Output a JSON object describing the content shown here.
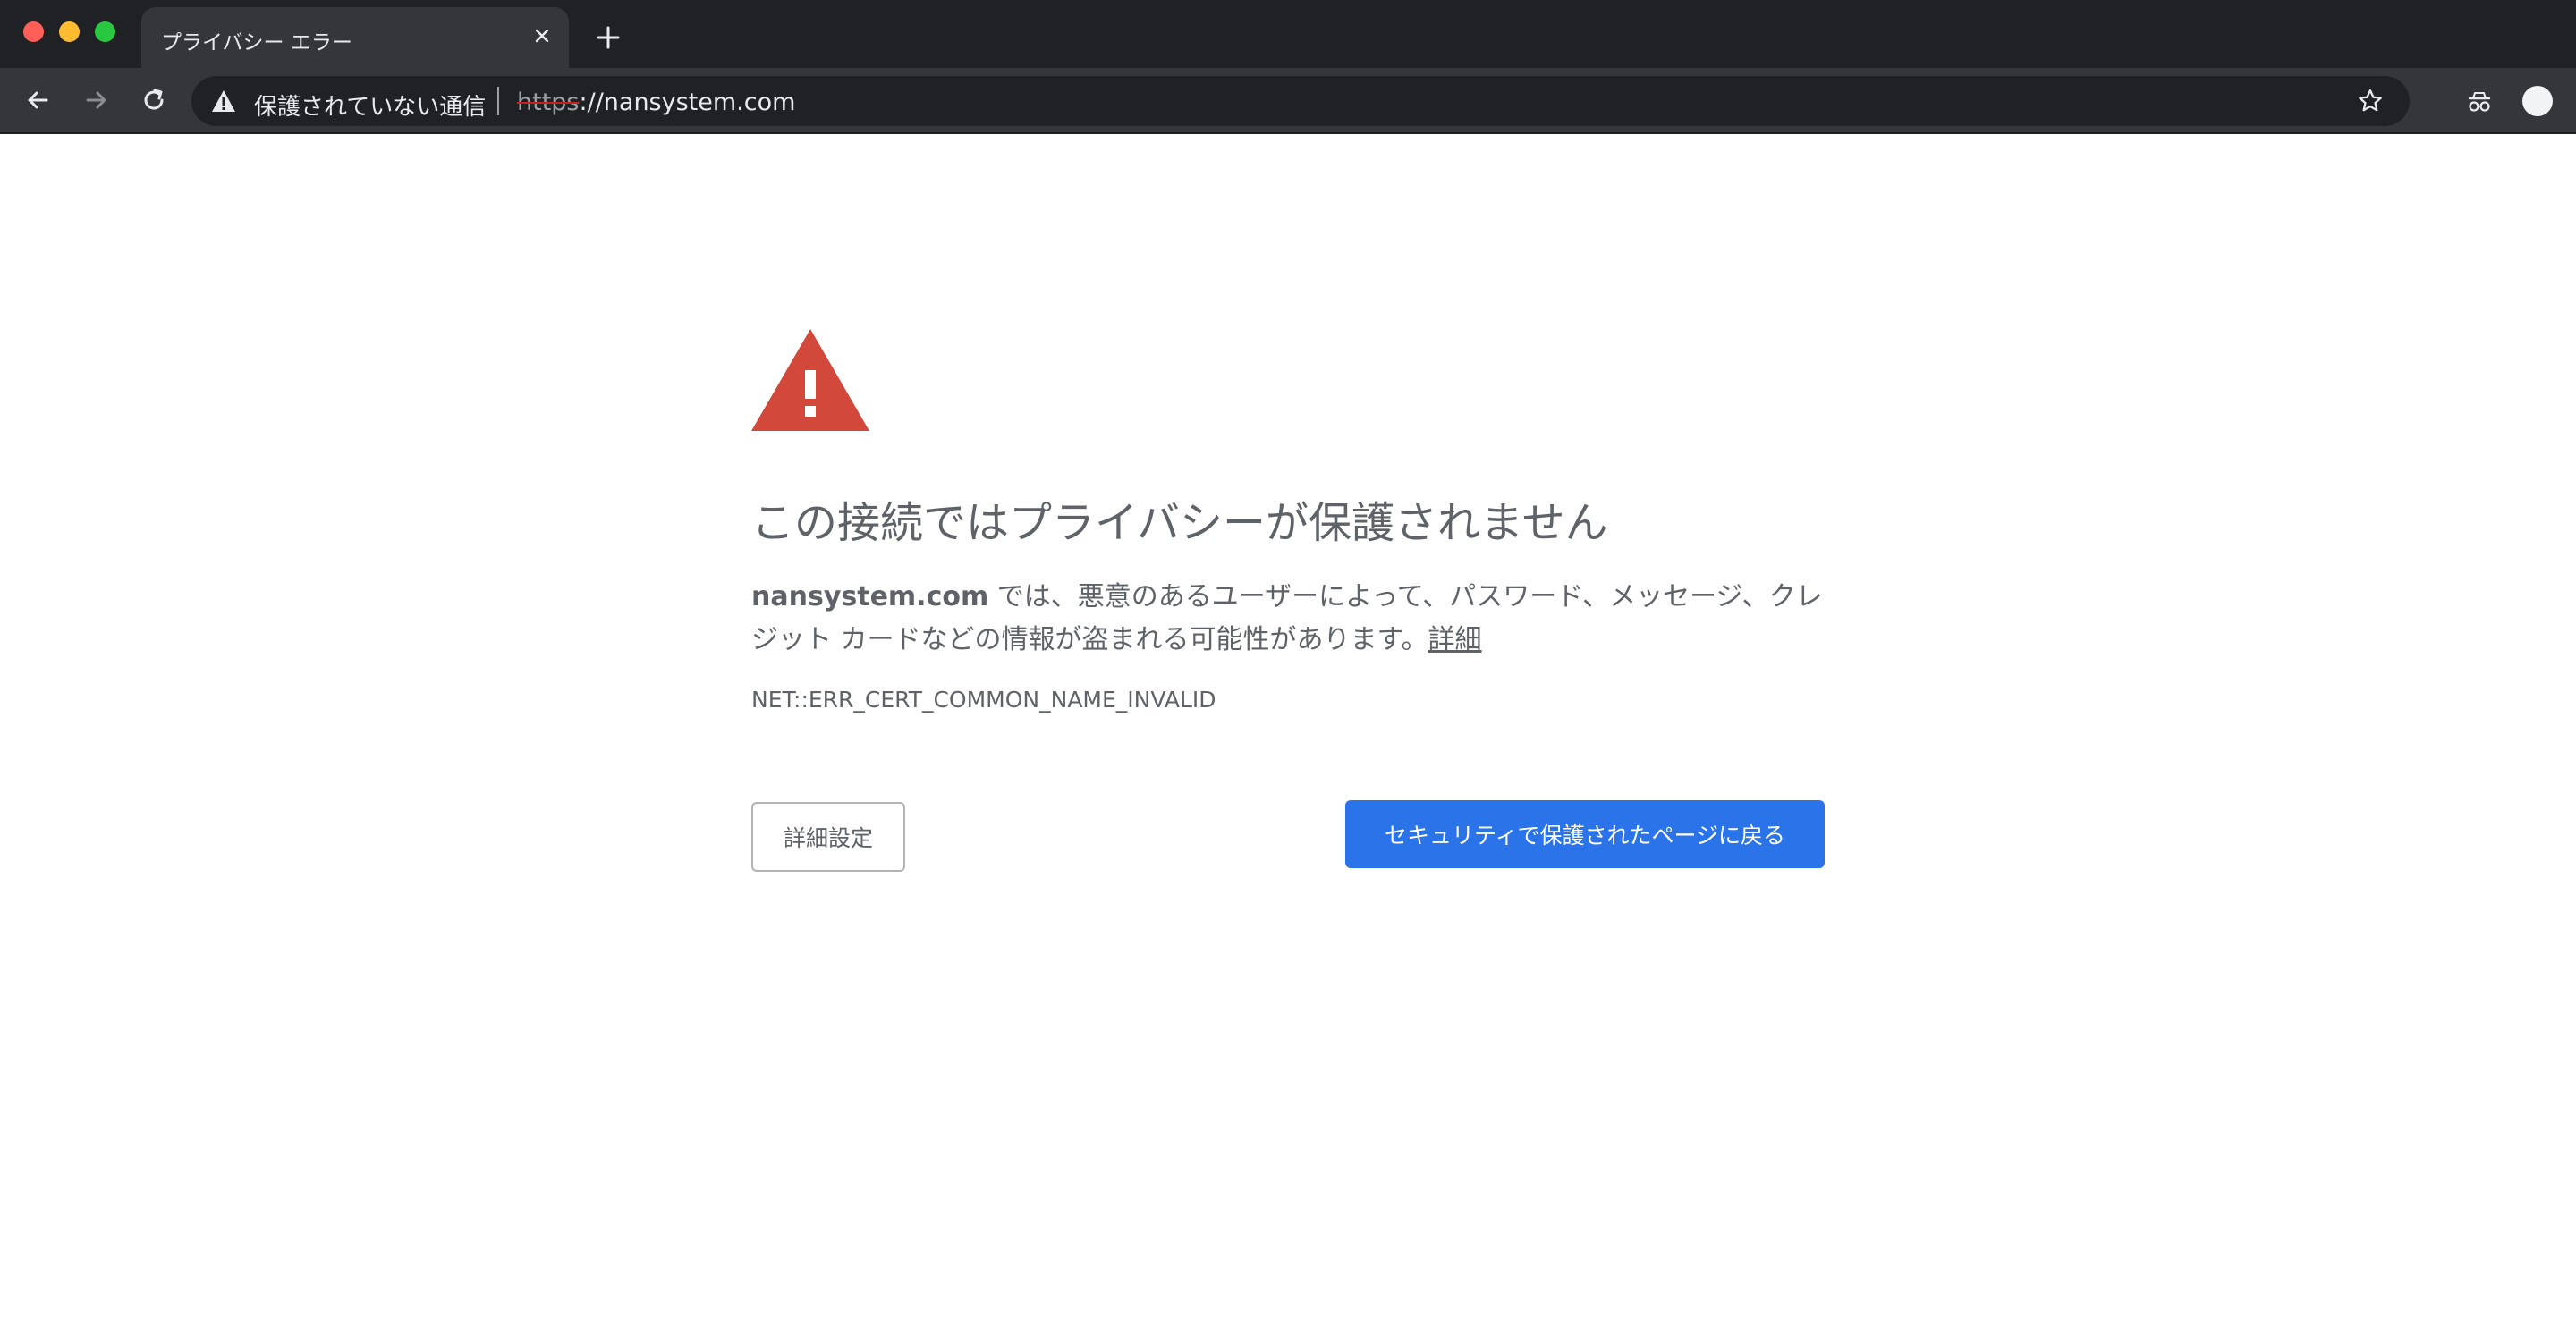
{
  "browser": {
    "tab": {
      "title": "プライバシー エラー",
      "close_icon": "close-icon"
    },
    "new_tab_icon": "plus-icon",
    "toolbar": {
      "back_icon": "arrow-left-icon",
      "forward_icon": "arrow-right-icon",
      "reload_icon": "reload-icon",
      "security_icon": "warning-triangle-icon",
      "security_label": "保護されていない通信",
      "url_scheme": "https",
      "url_rest": "://nansystem.com",
      "bookmark_icon": "star-icon",
      "extension_icon": "incognito-glasses-icon",
      "profile_icon": "profile-avatar-icon"
    }
  },
  "interstitial": {
    "icon": "red-warning-triangle-icon",
    "heading": "この接続ではプライバシーが保護されません",
    "host": "nansystem.com",
    "explanation": " では、悪意のあるユーザーによって、パスワード、メッセージ、クレジット カードなどの情報が盗まれる可能性があります。",
    "details_link": "詳細",
    "error_code": "NET::ERR_CERT_COMMON_NAME_INVALID",
    "advanced_button": "詳細設定",
    "back_button": "セキュリティで保護されたページに戻る"
  },
  "colors": {
    "chrome_dark": "#202124",
    "toolbar": "#35363a",
    "warning_red": "#d2483b",
    "primary_blue": "#2a73e8",
    "text_gray": "#5f6368"
  }
}
